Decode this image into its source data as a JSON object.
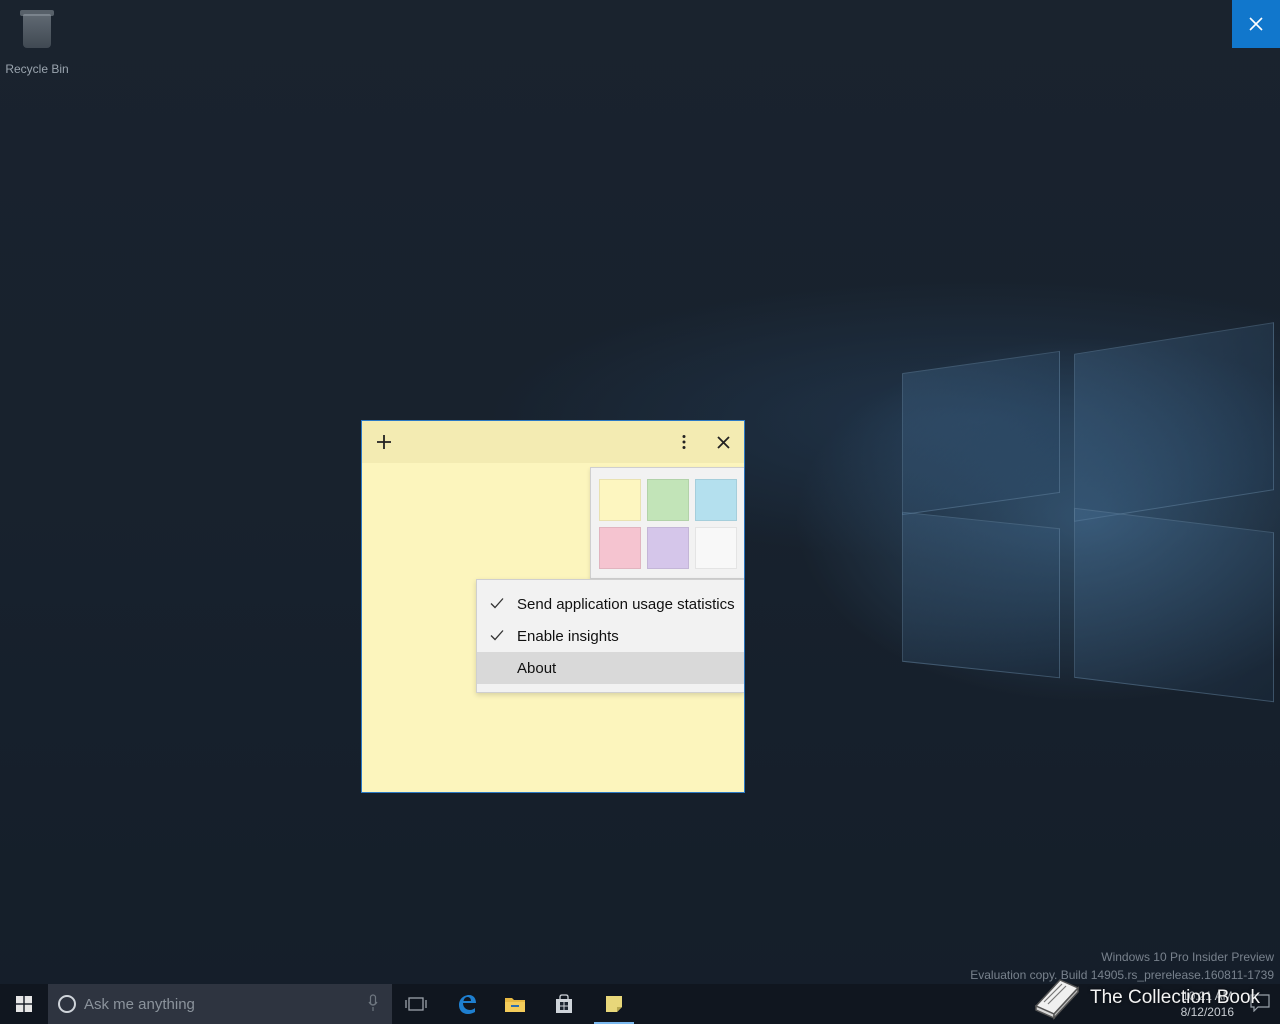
{
  "desktop": {
    "recycle_bin_label": "Recycle Bin",
    "watermark_line1": "Windows 10 Pro Insider Preview",
    "watermark_line2": "Evaluation copy. Build 14905.rs_prerelease.160811-1739"
  },
  "sticky_note": {
    "header": {
      "add_icon": "plus-icon",
      "menu_icon": "more-vertical-icon",
      "close_icon": "close-icon"
    },
    "palette": {
      "colors": [
        {
          "name": "yellow",
          "hex": "#fdf6c0"
        },
        {
          "name": "green",
          "hex": "#c2e4b8"
        },
        {
          "name": "blue",
          "hex": "#b4e0ee"
        },
        {
          "name": "pink",
          "hex": "#f5c4d0"
        },
        {
          "name": "purple",
          "hex": "#d5c6ea"
        },
        {
          "name": "white",
          "hex": "#f8f8f8"
        }
      ]
    },
    "menu": {
      "items": [
        {
          "label": "Send application usage statistics",
          "checked": true
        },
        {
          "label": "Enable insights",
          "checked": true
        },
        {
          "label": "About",
          "checked": false
        }
      ]
    },
    "colors": {
      "body": "#fcf5bd",
      "header": "#f3ebb2",
      "border": "#2b79c5"
    }
  },
  "taskbar": {
    "search_placeholder": "Ask me anything",
    "time": "10:21 AM",
    "date": "8/12/2016"
  },
  "branding": {
    "text": "The Collection Book"
  }
}
